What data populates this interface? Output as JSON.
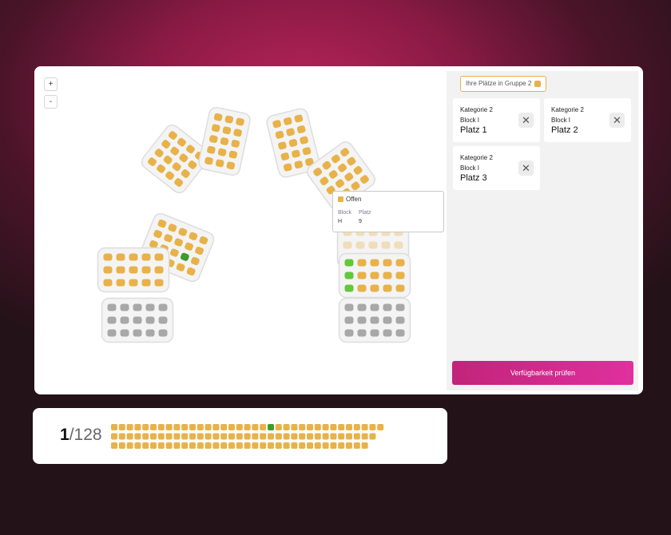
{
  "map": {
    "zoom_in_label": "+",
    "zoom_out_label": "-",
    "colors": {
      "available": "#e8b24a",
      "selected": "#3f9b2c",
      "group": "#62c83a",
      "unavailable": "#a8a8a8"
    }
  },
  "tooltip": {
    "status": "Offen",
    "block_header": "Block",
    "seat_header": "Platz",
    "block_value": "H",
    "seat_value": "9"
  },
  "panel": {
    "group_label": "Ihre Plätze in Gruppe 2",
    "seats": [
      {
        "category": "Kategorie 2",
        "block": "Block I",
        "seat": "Platz 1"
      },
      {
        "category": "Kategorie 2",
        "block": "Block I",
        "seat": "Platz 2"
      },
      {
        "category": "Kategorie 2",
        "block": "Block I",
        "seat": "Platz 3"
      }
    ],
    "remove_icon": "close-icon",
    "remove_glyph": "✕",
    "check_button_label": "Verfügbarkeit prüfen"
  },
  "counter": {
    "current": "1",
    "total": "/128",
    "strip_total": 128,
    "strip_selected_index": 20
  }
}
